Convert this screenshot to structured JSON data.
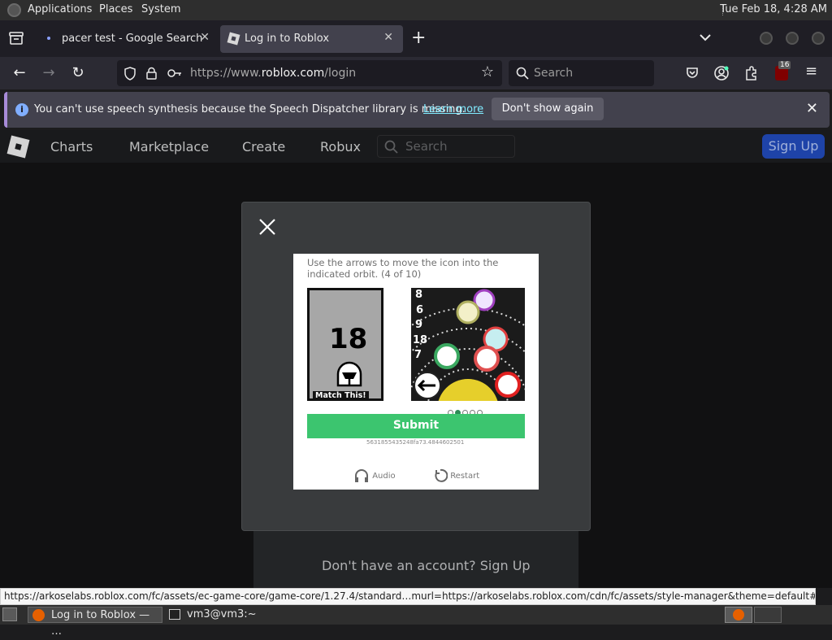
{
  "panel": {
    "applications": "Applications",
    "places": "Places",
    "system": "System",
    "clock": "Tue Feb 18,  4:28 AM"
  },
  "tabs": [
    {
      "label": "pacer test - Google Search"
    },
    {
      "label": "Log in to Roblox"
    }
  ],
  "navbar": {
    "url_prefix": "https://www.",
    "url_domain": "roblox.com",
    "url_path": "/login",
    "search_placeholder": "Search",
    "ublock_badge": "16"
  },
  "notification": {
    "message": "You can't use speech synthesis because the Speech Dispatcher library is missing.",
    "learn_more": "Learn more",
    "dont_show": "Don't show again"
  },
  "roblox": {
    "nav": [
      "Charts",
      "Marketplace",
      "Create",
      "Robux"
    ],
    "search_placeholder": "Search",
    "signup": "Sign Up",
    "no_account": "Don't have an account?",
    "signup_link": "Sign Up"
  },
  "captcha": {
    "instruction": "Use the arrows to move the icon into the indicated orbit. (4 of 10)",
    "card_number": "18",
    "match_label": "Match This!",
    "orbit_numbers": [
      "8",
      "6",
      "9",
      "18",
      "7"
    ],
    "progress": {
      "current": 2,
      "total": 5
    },
    "submit": "Submit",
    "session_id": "5631855435248fa73.4844602501",
    "audio": "Audio",
    "restart": "Restart"
  },
  "status_url": "https://arkoselabs.roblox.com/fc/assets/ec-game-core/game-core/1.27.4/standard…murl=https://arkoselabs.roblox.com/cdn/fc/assets/style-manager&theme=default#",
  "taskbar": {
    "firefox_task": "Log in to Roblox — …",
    "terminal_task": "vm3@vm3:~"
  }
}
